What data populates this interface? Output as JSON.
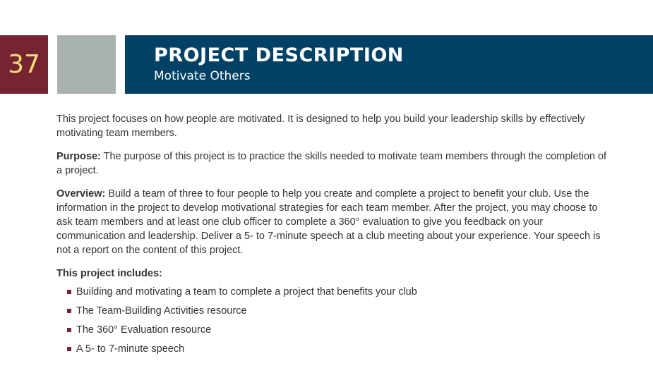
{
  "header": {
    "page_number": "37",
    "title": "PROJECT DESCRIPTION",
    "subtitle": "Motivate Others"
  },
  "body": {
    "intro": "This project focuses on how people are motivated. It is designed to help you build your leadership skills by effectively motivating team members.",
    "purpose_label": "Purpose:",
    "purpose_text": " The purpose of this project is to practice the skills needed to motivate team members through the completion of a project.",
    "overview_label": "Overview:",
    "overview_text": " Build a team of three to four people to help you create and complete a project to benefit your club. Use the information in the project to develop motivational strategies for each team member. After the project, you may choose to ask team members and at least one club officer to complete a 360° evaluation to give you feedback on your communication and leadership. Deliver a 5- to 7-minute speech at a club meeting about your experience. Your speech is not a report on the content of this project.",
    "includes_heading": "This project includes:",
    "includes_items": [
      "Building and motivating a team to complete a project that benefits your club",
      "The Team-Building Activities resource",
      "The 360° Evaluation resource",
      "A 5- to 7-minute speech"
    ]
  },
  "colors": {
    "page_number_bg": "#772432",
    "page_number_text": "#f2df74",
    "gray_box": "#a9b2b1",
    "header_bg": "#004165",
    "bullet": "#772432"
  }
}
